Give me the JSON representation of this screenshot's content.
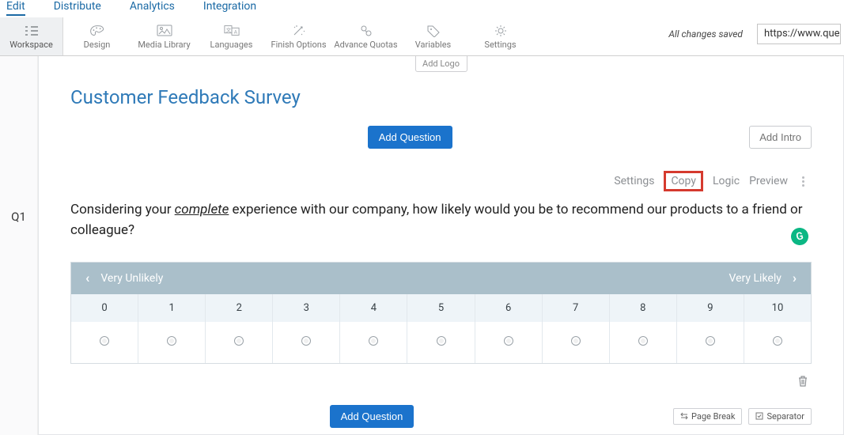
{
  "nav": {
    "edit": "Edit",
    "distribute": "Distribute",
    "analytics": "Analytics",
    "integration": "Integration"
  },
  "toolbar": {
    "workspace": "Workspace",
    "design": "Design",
    "media": "Media Library",
    "languages": "Languages",
    "finish": "Finish Options",
    "quotas": "Advance Quotas",
    "variables": "Variables",
    "settings": "Settings"
  },
  "status": {
    "saved": "All changes saved",
    "url": "https://www.questi"
  },
  "survey": {
    "add_logo": "Add Logo",
    "title": "Customer Feedback Survey",
    "add_question": "Add Question",
    "add_intro": "Add Intro"
  },
  "q1": {
    "id": "Q1",
    "actions": {
      "settings": "Settings",
      "copy": "Copy",
      "logic": "Logic",
      "preview": "Preview"
    },
    "text_pre": "Considering your ",
    "text_em": "complete",
    "text_post": " experience with our company, how likely would you be to recommend our products to a friend or colleague?",
    "badge": "G",
    "scale": {
      "low": "Very Unlikely",
      "high": "Very Likely",
      "points": [
        "0",
        "1",
        "2",
        "3",
        "4",
        "5",
        "6",
        "7",
        "8",
        "9",
        "10"
      ]
    }
  },
  "footer": {
    "page_break": "Page Break",
    "separator": "Separator"
  }
}
